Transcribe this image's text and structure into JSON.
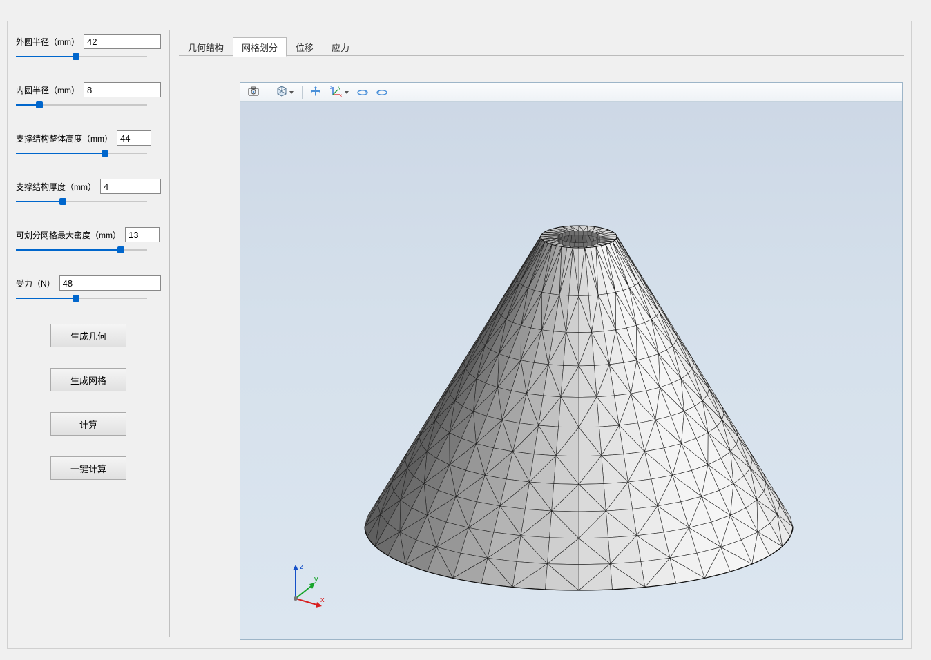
{
  "sidebar": {
    "params": [
      {
        "label": "外圆半径（mm）",
        "value": "42",
        "pct": 46
      },
      {
        "label": "内圆半径（mm）",
        "value": "8",
        "pct": 18
      },
      {
        "label": "支撑结构整体高度（mm）",
        "value": "44",
        "pct": 68
      },
      {
        "label": "支撑结构厚度（mm）",
        "value": "4",
        "pct": 36
      },
      {
        "label": "可划分网格最大密度（mm）",
        "value": "13",
        "pct": 80
      },
      {
        "label": "受力（N）",
        "value": "48",
        "pct": 46
      }
    ],
    "buttons": {
      "gen_geom": "生成几何",
      "gen_mesh": "生成网格",
      "compute": "计算",
      "oneclick": "一键计算"
    }
  },
  "tabs": {
    "items": [
      {
        "id": "geom",
        "label": "几何结构"
      },
      {
        "id": "mesh",
        "label": "网格划分"
      },
      {
        "id": "disp",
        "label": "位移"
      },
      {
        "id": "stress",
        "label": "应力"
      }
    ],
    "active": "mesh"
  },
  "toolbar": {
    "icons": {
      "camera": "camera-icon",
      "cube": "cube-view-icon",
      "pan": "pan-icon",
      "axes": "axes-icon",
      "rot_cw": "rotate-cw-icon",
      "rot_ccw": "rotate-ccw-icon"
    }
  },
  "gizmo": {
    "x": "x",
    "y": "y",
    "z": "z"
  },
  "model": {
    "type": "cone_mesh",
    "outer_radius_mm": 42,
    "inner_radius_mm": 8,
    "height_mm": 44,
    "thickness_mm": 4
  }
}
